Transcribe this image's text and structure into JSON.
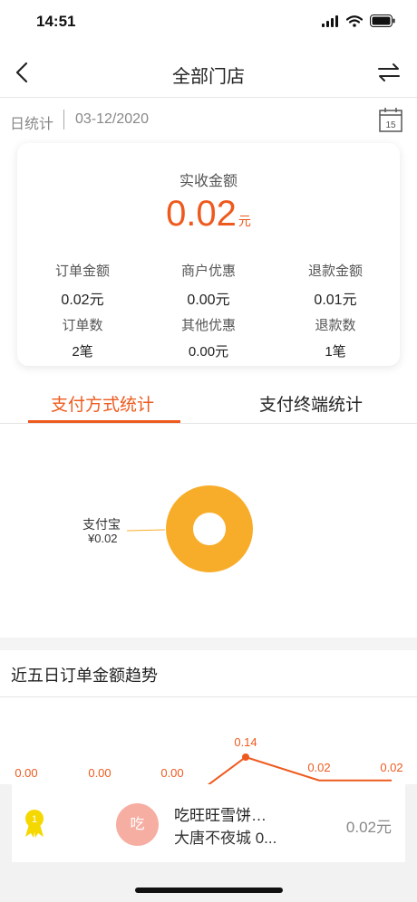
{
  "status_bar": {
    "time": "14:51"
  },
  "nav": {
    "title": "全部门店"
  },
  "date_bar": {
    "type": "日统计",
    "date": "03-12/2020",
    "calendar_day": "15"
  },
  "summary": {
    "main_label": "实收金额",
    "main_value": "0.02",
    "main_unit": "元",
    "stats": [
      {
        "label": "订单金额",
        "value": "0.02元"
      },
      {
        "label": "商户优惠",
        "value": "0.00元"
      },
      {
        "label": "退款金额",
        "value": "0.01元"
      },
      {
        "label": "订单数",
        "value": "2笔"
      },
      {
        "label": "其他优惠",
        "value": "0.00元"
      },
      {
        "label": "退款数",
        "value": "1笔"
      }
    ]
  },
  "tabs": [
    {
      "label": "支付方式统计",
      "active": true
    },
    {
      "label": "支付终端统计",
      "active": false
    }
  ],
  "payment_chart": {
    "type": "pie",
    "slices": [
      {
        "name": "支付宝",
        "label": "¥0.02",
        "value": 0.02,
        "color": "#f8ad2a"
      }
    ]
  },
  "trend": {
    "title": "近五日订单金额趋势",
    "chart_data": {
      "type": "line",
      "values": [
        0.0,
        0.0,
        0.0,
        0.14,
        0.02,
        0.02
      ],
      "labels": [
        "0.00",
        "0.00",
        "0.00",
        "0.14",
        "0.02",
        "0.02"
      ],
      "color": "#ee5a1e"
    }
  },
  "store": {
    "avatar_text": "吃",
    "rank": "1",
    "name": "吃旺旺雪饼…",
    "sub": "大唐不夜城 0...",
    "amount": "0.02元"
  },
  "colors": {
    "accent": "#ee5a1e",
    "donut": "#f8ad2a",
    "avatar": "#f7aea2",
    "rank_badge": "#f5d800"
  }
}
